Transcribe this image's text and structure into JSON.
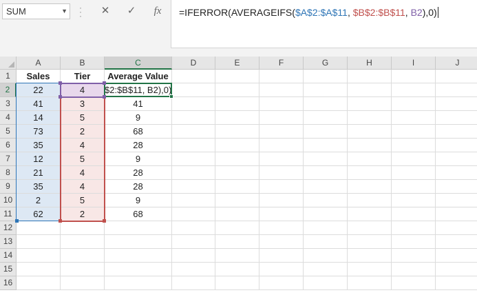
{
  "formula_bar": {
    "name_box": "SUM",
    "cancel_icon": "✕",
    "enter_icon": "✓",
    "insert_function_label": "fx",
    "formula_parts": {
      "prefix": "=IFERROR(AVERAGEIFS(",
      "ref_a": "$A$2:$A$11",
      "sep1": ", ",
      "ref_b": "$B$2:$B$11",
      "sep2": ", ",
      "ref_b2": "B2",
      "suffix": "),0)"
    }
  },
  "columns": [
    "A",
    "B",
    "C",
    "D",
    "E",
    "F",
    "G",
    "H",
    "I",
    "J"
  ],
  "rows": [
    "1",
    "2",
    "3",
    "4",
    "5",
    "6",
    "7",
    "8",
    "9",
    "10",
    "11",
    "12",
    "13",
    "14",
    "15",
    "16"
  ],
  "headers": {
    "a": "Sales",
    "b": "Tier",
    "c": "Average Value"
  },
  "table": [
    {
      "sales": "22",
      "tier": "4",
      "avg": "$2:$B$11, B2),0)"
    },
    {
      "sales": "41",
      "tier": "3",
      "avg": "41"
    },
    {
      "sales": "14",
      "tier": "5",
      "avg": "9"
    },
    {
      "sales": "73",
      "tier": "2",
      "avg": "68"
    },
    {
      "sales": "35",
      "tier": "4",
      "avg": "28"
    },
    {
      "sales": "12",
      "tier": "5",
      "avg": "9"
    },
    {
      "sales": "21",
      "tier": "4",
      "avg": "28"
    },
    {
      "sales": "35",
      "tier": "4",
      "avg": "28"
    },
    {
      "sales": "2",
      "tier": "5",
      "avg": "9"
    },
    {
      "sales": "62",
      "tier": "2",
      "avg": "68"
    }
  ],
  "active_cell": "C2",
  "colors": {
    "accent_green": "#217346",
    "range_a": "#2e75b6",
    "range_b": "#c0504d",
    "range_b2": "#7f5fa8"
  }
}
